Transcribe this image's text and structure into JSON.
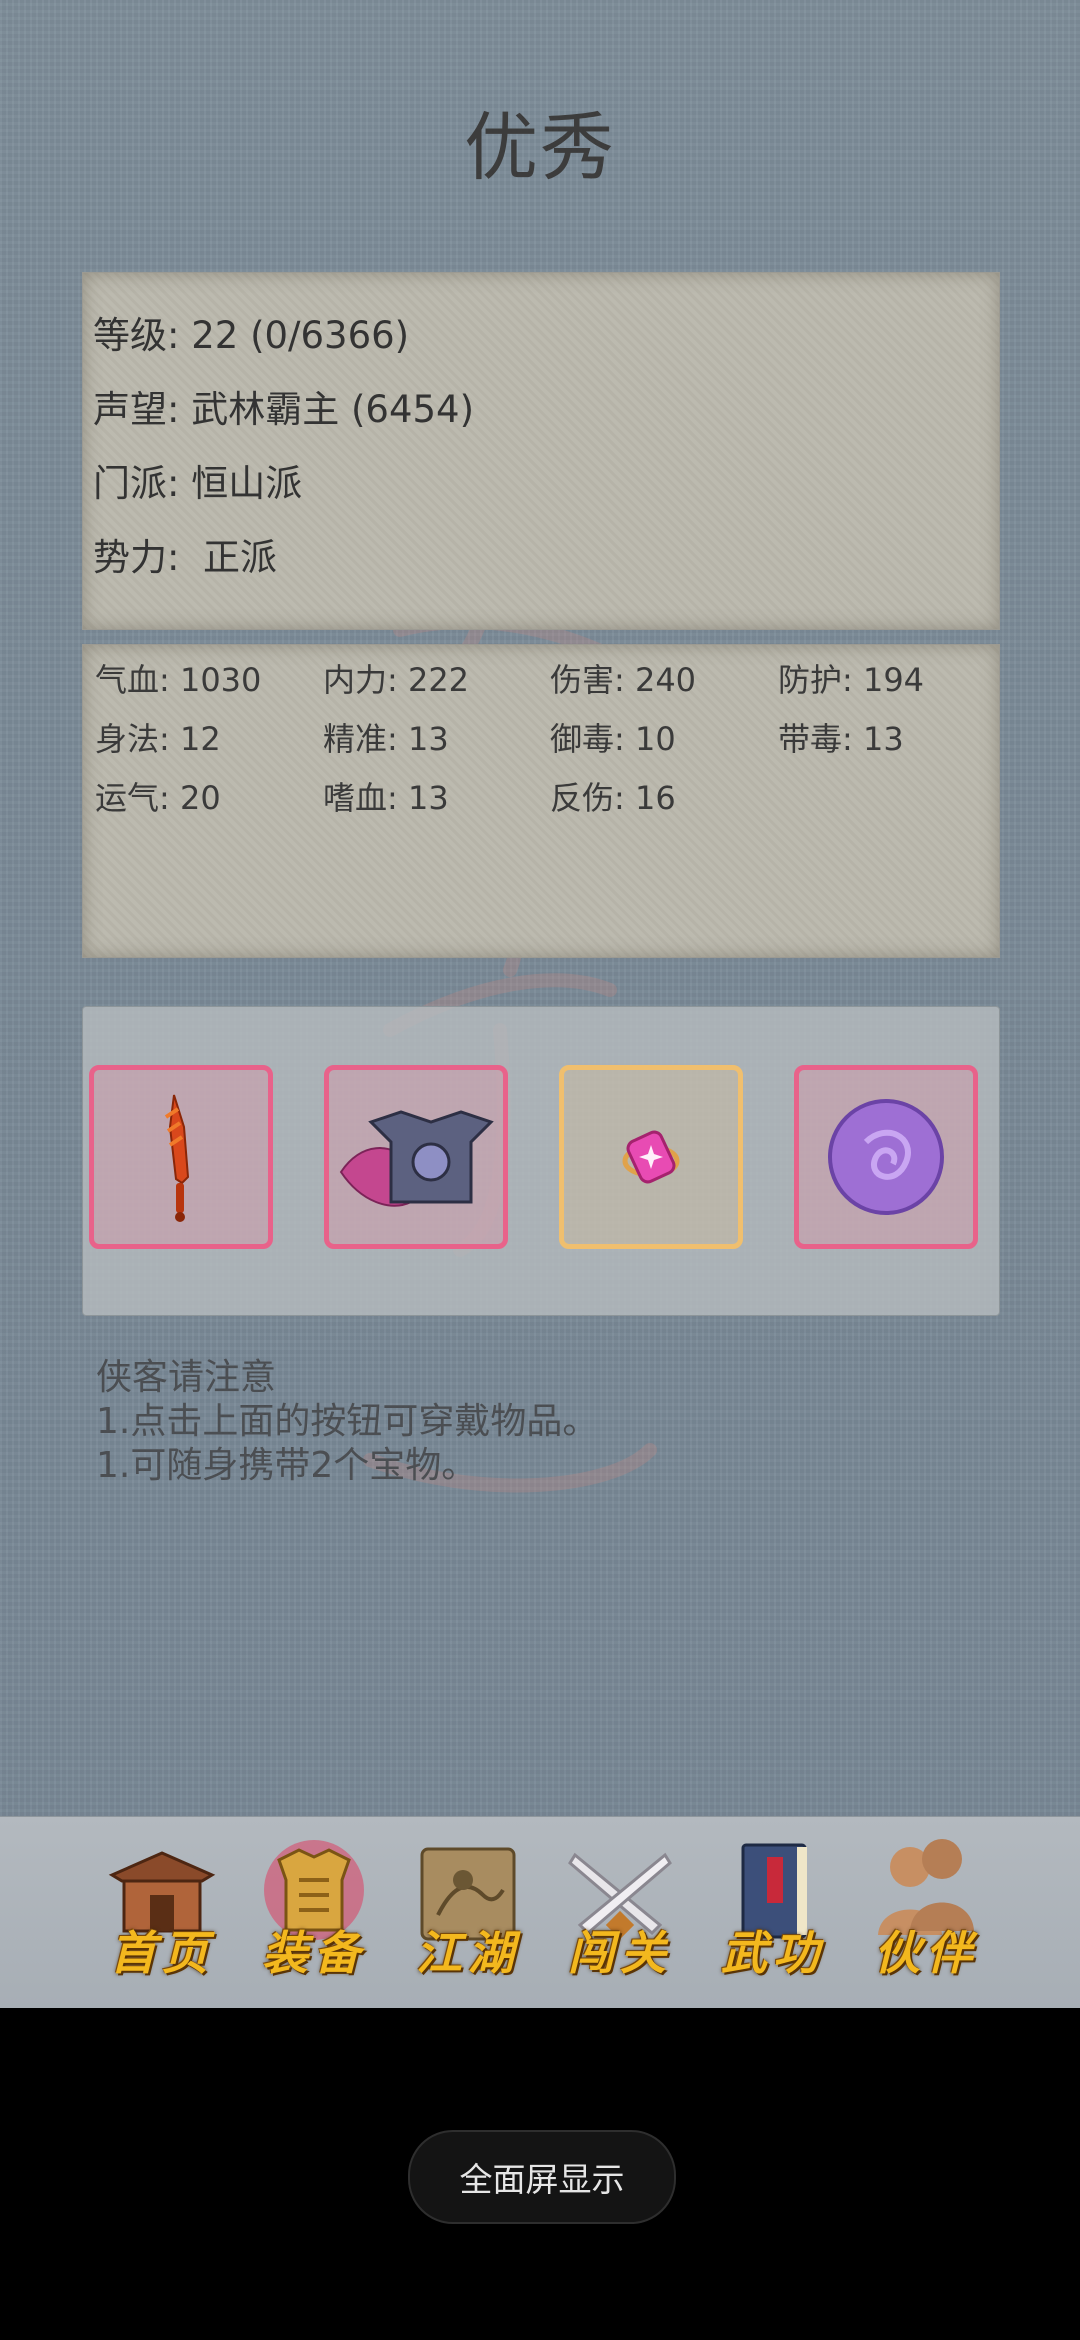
{
  "title": "优秀",
  "info": {
    "level": "等级: 22 (0/6366)",
    "reputation": "声望: 武林霸主 (6454)",
    "sect": "门派: 恒山派",
    "faction": "势力:  正派"
  },
  "stats": [
    "气血: 1030",
    "内力: 222",
    "伤害: 240",
    "防护: 194",
    "身法: 12",
    "精准: 13",
    "御毒: 10",
    "带毒: 13",
    "运气: 20",
    "嗜血: 13",
    "反伤: 16"
  ],
  "equipment": [
    {
      "icon": "sword-icon",
      "color": "#e8628a"
    },
    {
      "icon": "armor-icon",
      "color": "#e8628a"
    },
    {
      "icon": "gem-charm-icon",
      "color": "#f0bf6e"
    },
    {
      "icon": "purple-orb-icon",
      "color": "#e8628a"
    }
  ],
  "notice": {
    "heading": "侠客请注意",
    "line1": "1.点击上面的按钮可穿戴物品。",
    "line2": "1.可随身携带2个宝物。"
  },
  "nav": [
    {
      "label": "首页",
      "icon": "temple-icon"
    },
    {
      "label": "装备",
      "icon": "armor-icon"
    },
    {
      "label": "江湖",
      "icon": "scroll-map-icon"
    },
    {
      "label": "闯关",
      "icon": "crossed-swords-icon"
    },
    {
      "label": "武功",
      "icon": "book-icon"
    },
    {
      "label": "伙伴",
      "icon": "companions-icon"
    }
  ],
  "fullscreen_button": "全面屏显示"
}
